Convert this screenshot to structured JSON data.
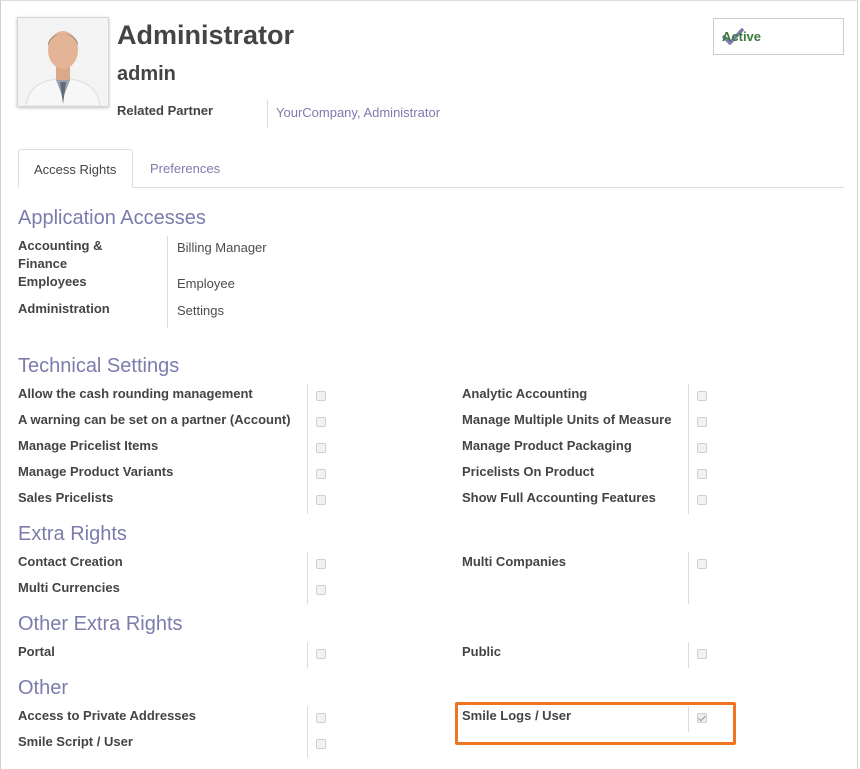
{
  "user": {
    "name": "Administrator",
    "login": "admin",
    "related_partner_label": "Related Partner",
    "related_partner_value": "YourCompany, Administrator",
    "status_label": "Active"
  },
  "tabs": [
    {
      "label": "Access Rights",
      "active": true
    },
    {
      "label": "Preferences",
      "active": false
    }
  ],
  "application_accesses": {
    "title": "Application Accesses",
    "rows": [
      {
        "label": "Accounting & Finance",
        "value": "Billing Manager"
      },
      {
        "label": "Employees",
        "value": "Employee"
      },
      {
        "label": "Administration",
        "value": "Settings"
      }
    ]
  },
  "technical_settings": {
    "title": "Technical Settings",
    "left": [
      {
        "label": "Allow the cash rounding management",
        "checked": false
      },
      {
        "label": "A warning can be set on a partner (Account)",
        "checked": false
      },
      {
        "label": "Manage Pricelist Items",
        "checked": false
      },
      {
        "label": "Manage Product Variants",
        "checked": false
      },
      {
        "label": "Sales Pricelists",
        "checked": false
      }
    ],
    "right": [
      {
        "label": "Analytic Accounting",
        "checked": false
      },
      {
        "label": "Manage Multiple Units of Measure",
        "checked": false
      },
      {
        "label": "Manage Product Packaging",
        "checked": false
      },
      {
        "label": "Pricelists On Product",
        "checked": false
      },
      {
        "label": "Show Full Accounting Features",
        "checked": false
      }
    ]
  },
  "extra_rights": {
    "title": "Extra Rights",
    "left": [
      {
        "label": "Contact Creation",
        "checked": false
      },
      {
        "label": "Multi Currencies",
        "checked": false
      }
    ],
    "right": [
      {
        "label": "Multi Companies",
        "checked": false
      }
    ]
  },
  "other_extra_rights": {
    "title": "Other Extra Rights",
    "left": [
      {
        "label": "Portal",
        "checked": false
      }
    ],
    "right": [
      {
        "label": "Public",
        "checked": false
      }
    ]
  },
  "other": {
    "title": "Other",
    "left": [
      {
        "label": "Access to Private Addresses",
        "checked": false
      },
      {
        "label": "Smile Script / User",
        "checked": false
      }
    ],
    "right": [
      {
        "label": "Smile Logs / User",
        "checked": true
      }
    ]
  },
  "colors": {
    "section_title": "#7c7bad",
    "link": "#7c7bad",
    "highlight": "#f07320",
    "active_check": "#7c7bad"
  }
}
